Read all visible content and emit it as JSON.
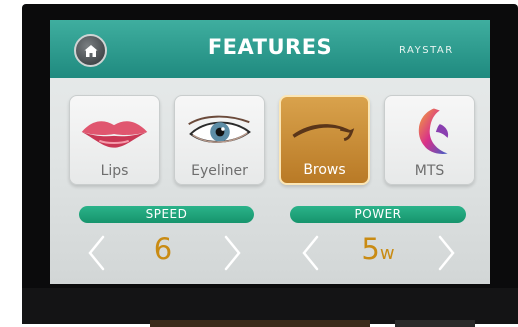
{
  "header": {
    "title": "FEATURES",
    "brand": "RAYSTAR"
  },
  "features": [
    {
      "label": "Lips"
    },
    {
      "label": "Eyeliner"
    },
    {
      "label": "Brows"
    },
    {
      "label": "MTS"
    }
  ],
  "selected_feature": "Brows",
  "controls": {
    "speed": {
      "label": "SPEED",
      "value": "6"
    },
    "power": {
      "label": "POWER",
      "value": "5",
      "unit": "w"
    }
  },
  "colors": {
    "header": "#2a9d8f",
    "accent_gold": "#c98b13",
    "pill_green": "#1fa37b"
  },
  "icons": [
    "home-icon",
    "lips-icon",
    "eye-icon",
    "brow-icon",
    "mts-logo-icon",
    "chevron-left-icon",
    "chevron-right-icon"
  ]
}
